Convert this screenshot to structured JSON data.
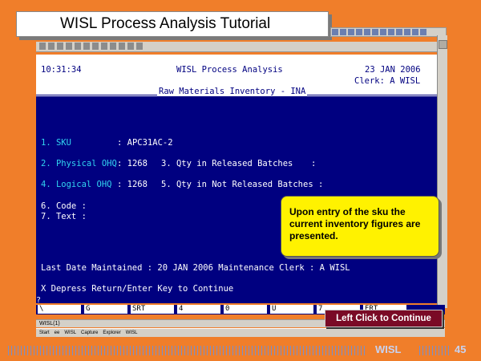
{
  "slide": {
    "title": "WISL Process Analysis Tutorial",
    "footer_brand": "WISL",
    "page_number": "45",
    "continue_button": "Left Click to Continue",
    "callout_text": "Upon entry of the sku the current inventory figures are presented."
  },
  "terminal": {
    "time": "10:31:34",
    "app_title": "WISL Process Analysis",
    "date": "23 JAN 2006",
    "clerk": "Clerk: A WISL",
    "screen_title": "Raw Materials Inventory - INA",
    "fields": {
      "sku_label": "1. SKU",
      "sku_value": ": APC31AC-2",
      "physical_label": "2. Physical OHQ",
      "physical_value": ": 1268",
      "qty_released_label": "3. Qty in Released Batches",
      "qty_released_value": ":",
      "logical_label": "4. Logical OHQ",
      "logical_value": ": 1268",
      "qty_not_released_label": "5. Qty in Not Released Batches :",
      "code_label": "6. Code :",
      "text_label": "7. Text :"
    },
    "last_date_line": "Last Date Maintained : 20 JAN 2006 Maintenance Clerk : A WISL",
    "prompt": "X Depress Return/Enter Key to Continue",
    "cursor_char": "?",
    "function_keys": [
      "\\",
      "G",
      "SRT",
      "4",
      "0",
      "U",
      "7",
      "ERT"
    ]
  },
  "status_text": "WISL(1)",
  "taskbar_items": [
    "Start",
    "ee",
    "WISL",
    "Capture",
    "Explorer",
    "WISL"
  ]
}
